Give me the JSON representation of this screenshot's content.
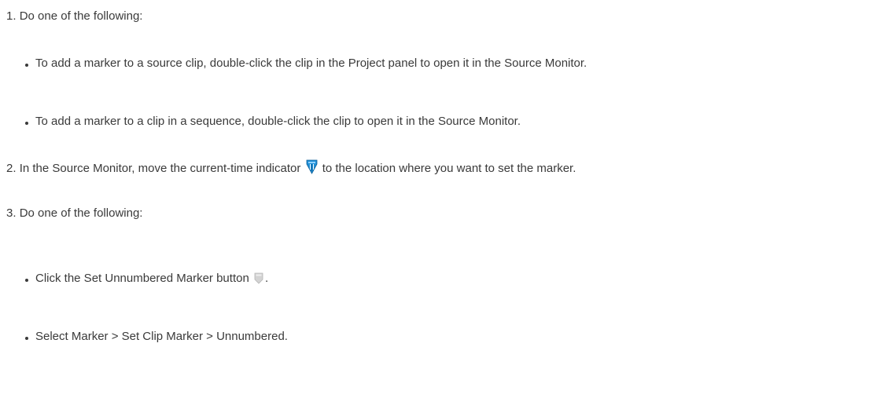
{
  "steps": [
    {
      "number": "1.",
      "text": "Do one of the following:",
      "options": [
        "To add a marker to a source clip, double-click the clip in the Project panel to open it in the Source Monitor.",
        "To add a marker to a clip in a sequence, double-click the clip to open it in the Source Monitor."
      ]
    },
    {
      "number": "2.",
      "text_before_icon": "In the Source Monitor, move the current-time indicator",
      "icon": "current-time-indicator-icon",
      "text_after_icon": "to the location where you want to set the marker."
    },
    {
      "number": "3.",
      "text": "Do one of the following:",
      "option1_before_icon": "Click the Set Unnumbered Marker button",
      "option1_icon": "set-unnumbered-marker-icon",
      "option1_after_icon": ".",
      "option2": "Select Marker > Set Clip Marker > Unnumbered."
    }
  ],
  "colors": {
    "text": "#3a3a3a",
    "indicator_blue": "#1f8fd6",
    "marker_gray": "#c8c8c8"
  }
}
